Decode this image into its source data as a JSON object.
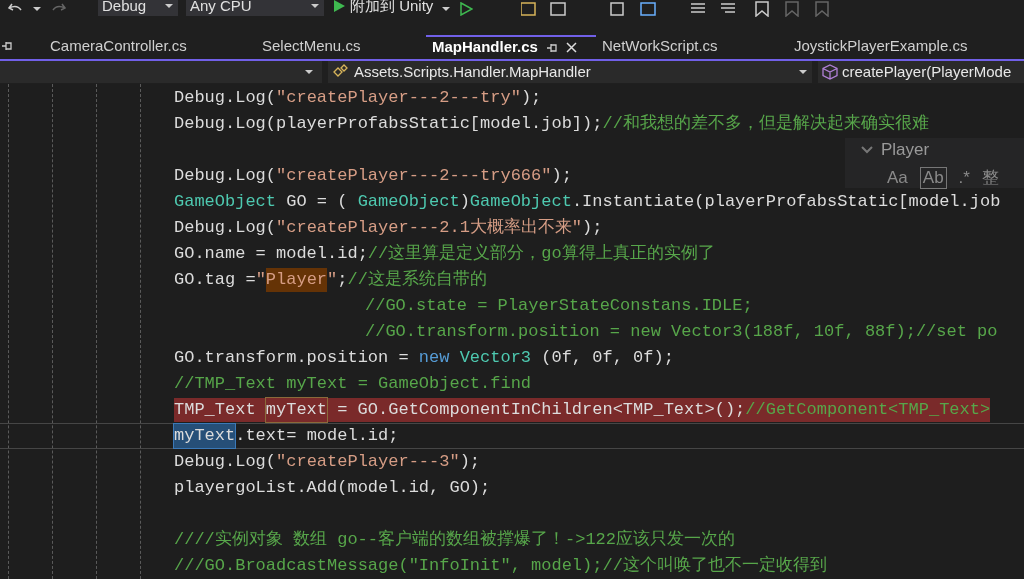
{
  "toolbar": {
    "configuration": "Debug",
    "platform": "Any CPU",
    "run_label": "附加到 Unity"
  },
  "tabs": [
    {
      "label": "CameraController.cs",
      "selected": false
    },
    {
      "label": "SelectMenu.cs",
      "selected": false
    },
    {
      "label": "MapHandler.cs",
      "selected": true
    },
    {
      "label": "NetWorkScript.cs",
      "selected": false
    },
    {
      "label": "JoystickPlayerExample.cs",
      "selected": false
    }
  ],
  "navigation": {
    "class_path": "Assets.Scripts.Handler.MapHandler",
    "member": "createPlayer(PlayerMode"
  },
  "find_panel": {
    "value": "Player",
    "options": [
      "Aa",
      "Ab",
      ".*",
      "整"
    ]
  },
  "code_lines": [
    {
      "kind": "plain",
      "error": false,
      "current": false,
      "tokens": [
        {
          "text": "Debug.Log(",
          "kind": "var"
        },
        {
          "text": "\"createPlayer---2---try\"",
          "kind": "str"
        },
        {
          "text": ");",
          "kind": "punct"
        }
      ]
    },
    {
      "kind": "plain",
      "error": false,
      "current": false,
      "tokens": [
        {
          "text": "Debug.Log(playerProfabsStatic[model.job]);",
          "kind": "var"
        },
        {
          "text": "//和我想的差不多，但是解决起来确实很难",
          "kind": "cmt"
        }
      ]
    },
    {
      "kind": "blank",
      "error": false,
      "current": false
    },
    {
      "kind": "plain",
      "error": false,
      "current": false,
      "tokens": [
        {
          "text": "Debug.Log(",
          "kind": "var"
        },
        {
          "text": "\"createPlayer---2---try666\"",
          "kind": "str"
        },
        {
          "text": ");",
          "kind": "punct"
        }
      ]
    },
    {
      "kind": "plain",
      "error": false,
      "current": false,
      "tokens": [
        {
          "text": "GameObject",
          "kind": "type"
        },
        {
          "text": "GO = (",
          "kind": "var"
        },
        {
          "text": "GameObject",
          "kind": "type"
        },
        {
          "text": ")",
          "kind": "punct"
        },
        {
          "text": "GameObject",
          "kind": "type"
        },
        {
          "text": ".Instantiate(playerProfabsStatic[model.job",
          "kind": "var"
        }
      ]
    },
    {
      "kind": "plain",
      "error": false,
      "current": false,
      "tokens": [
        {
          "text": "Debug.Log(",
          "kind": "var"
        },
        {
          "text": "\"createPlayer---2.1大概率出不来\"",
          "kind": "str"
        },
        {
          "text": ");",
          "kind": "punct"
        }
      ]
    },
    {
      "kind": "plain",
      "error": false,
      "current": false,
      "tokens": [
        {
          "text": "GO.name = model.id;",
          "kind": "var"
        },
        {
          "text": "//这里算是定义部分，go算得上真正的实例了",
          "kind": "cmt"
        }
      ]
    },
    {
      "kind": "plain",
      "error": false,
      "current": false,
      "tokens": [
        {
          "text": "GO.tag =",
          "kind": "var"
        },
        {
          "text": "\"",
          "kind": "str"
        },
        {
          "text": "Player",
          "kind": "match"
        },
        {
          "text": "\"",
          "kind": "str"
        },
        {
          "text": ";",
          "kind": "punct"
        },
        {
          "text": "//这是系统自带的",
          "kind": "cmt"
        }
      ]
    },
    {
      "kind": "indented",
      "error": false,
      "current": false,
      "tokens": [
        {
          "text": "//GO.state = PlayerStateConstans.IDLE;",
          "kind": "cmt"
        }
      ]
    },
    {
      "kind": "indented",
      "error": false,
      "current": false,
      "tokens": [
        {
          "text": "//GO.transform.position = new Vector3(188f, 10f, 88f);//set po",
          "kind": "cmt"
        }
      ]
    },
    {
      "kind": "plain",
      "error": false,
      "current": false,
      "tokens": [
        {
          "text": "GO.transform.position =",
          "kind": "var"
        },
        {
          "text": "new",
          "kind": "kw"
        },
        {
          "text": "Vector3",
          "kind": "type"
        },
        {
          "text": "(0f, 0f, 0f);",
          "kind": "var"
        }
      ]
    },
    {
      "kind": "plain",
      "error": false,
      "current": false,
      "tokens": [
        {
          "text": "//TMP_Text myText = GameObject.find",
          "kind": "cmt"
        }
      ]
    },
    {
      "kind": "plain",
      "error": true,
      "current": false,
      "tokens": [
        {
          "text": "TMP_Text",
          "kind": "var"
        },
        {
          "text": "myText",
          "kind": "reference"
        },
        {
          "text": "= GO.GetComponentInChildren<TMP_Text>();",
          "kind": "var"
        },
        {
          "text": "//GetComponent<TMP_Text>",
          "kind": "cmt"
        }
      ]
    },
    {
      "kind": "plain",
      "error": false,
      "current": true,
      "tokens": [
        {
          "text": "myText",
          "kind": "selection"
        },
        {
          "text": ".text= model.id;",
          "kind": "var"
        }
      ]
    },
    {
      "kind": "plain",
      "error": false,
      "current": false,
      "tokens": [
        {
          "text": "Debug.Log(",
          "kind": "var"
        },
        {
          "text": "\"createPlayer---3\"",
          "kind": "str"
        },
        {
          "text": ");",
          "kind": "punct"
        }
      ]
    },
    {
      "kind": "plain",
      "error": false,
      "current": false,
      "tokens": [
        {
          "text": "playergoList.Add(model.id, GO);",
          "kind": "var"
        }
      ]
    },
    {
      "kind": "blank",
      "error": false,
      "current": false
    },
    {
      "kind": "plain",
      "error": false,
      "current": false,
      "tokens": [
        {
          "text": "////实例对象 数组 go--客户端的数组被撑爆了！->122应该只发一次的",
          "kind": "cmt"
        }
      ]
    },
    {
      "kind": "plain",
      "error": false,
      "current": false,
      "tokens": [
        {
          "text": "///GO.BroadcastMessage(\"InfoInit\", model);//这个叫唤了也不一定收得到",
          "kind": "cmt"
        }
      ]
    }
  ]
}
